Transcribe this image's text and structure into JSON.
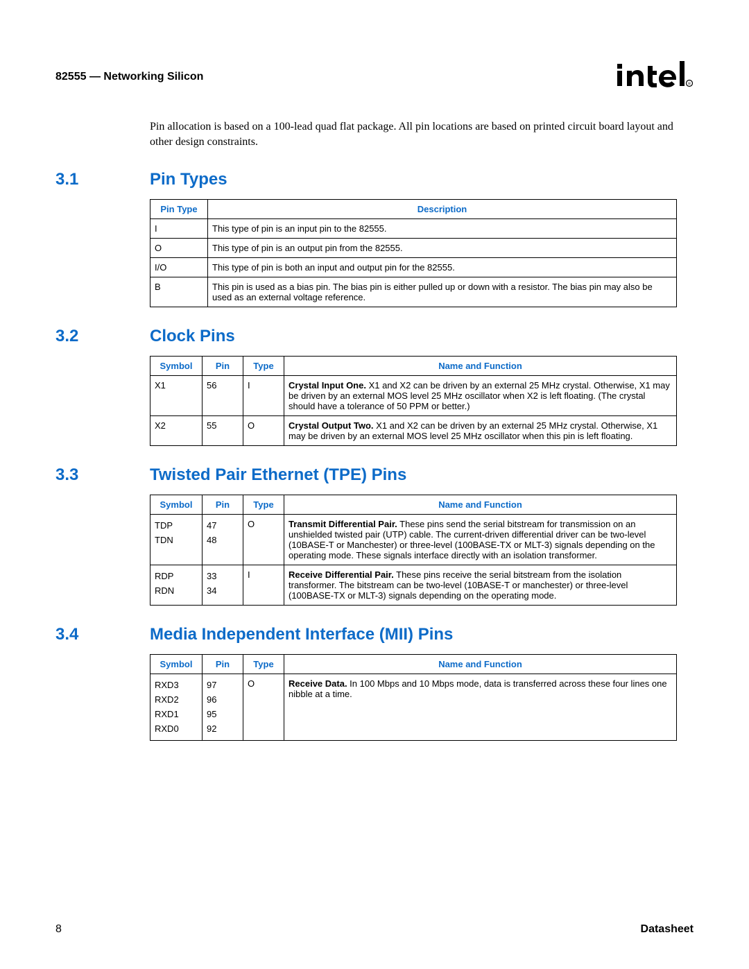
{
  "header": {
    "left": "82555 — Networking Silicon",
    "logo_alt": "intel"
  },
  "intro": "Pin allocation is based on a 100-lead quad flat package. All pin locations are based on printed circuit board layout and other design constraints.",
  "sections": {
    "s31": {
      "num": "3.1",
      "title": "Pin Types"
    },
    "s32": {
      "num": "3.2",
      "title": "Clock Pins"
    },
    "s33": {
      "num": "3.3",
      "title": "Twisted Pair Ethernet (TPE) Pins"
    },
    "s34": {
      "num": "3.4",
      "title": "Media Independent Interface (MII) Pins"
    }
  },
  "pin_type_table": {
    "headers": {
      "col0": "Pin Type",
      "col1": "Description"
    },
    "rows": [
      {
        "t": "I",
        "d": "This type of pin is an input pin to the 82555."
      },
      {
        "t": "O",
        "d": "This type of pin is an output pin from the 82555."
      },
      {
        "t": "I/O",
        "d": "This type of pin is both an input and output pin for the 82555."
      },
      {
        "t": "B",
        "d": "This pin is used as a bias pin. The bias pin is either pulled up or down with a resistor. The bias pin may also be used as an external voltage reference."
      }
    ]
  },
  "clock_table": {
    "headers": {
      "symbol": "Symbol",
      "pin": "Pin",
      "type": "Type",
      "func": "Name and Function"
    },
    "rows": [
      {
        "symbol": "X1",
        "pin": "56",
        "type": "I",
        "lead": "Crystal Input One.",
        "rest": " X1 and X2 can be driven by an external 25 MHz crystal. Otherwise, X1 may be driven by an external MOS level 25 MHz oscillator when X2 is left floating. (The crystal should have a tolerance of 50 PPM or better.)"
      },
      {
        "symbol": "X2",
        "pin": "55",
        "type": "O",
        "lead": "Crystal Output Two.",
        "rest": " X1 and X2 can be driven by an external 25 MHz crystal. Otherwise, X1 may be driven by an external MOS level 25 MHz oscillator when this pin is left floating."
      }
    ]
  },
  "tpe_table": {
    "headers": {
      "symbol": "Symbol",
      "pin": "Pin",
      "type": "Type",
      "func": "Name and Function"
    },
    "rows": [
      {
        "symbols": [
          "TDP",
          "TDN"
        ],
        "pins": [
          "47",
          "48"
        ],
        "type": "O",
        "lead": "Transmit Differential Pair.",
        "rest": " These pins send the serial bitstream for transmission on an unshielded twisted pair (UTP) cable. The current-driven differential driver can be two-level (10BASE-T or Manchester) or three-level (100BASE-TX or MLT-3) signals depending on the operating mode. These signals interface directly with an isolation transformer."
      },
      {
        "symbols": [
          "RDP",
          "RDN"
        ],
        "pins": [
          "33",
          "34"
        ],
        "type": "I",
        "lead": "Receive Differential Pair.",
        "rest": " These pins receive the serial bitstream from the isolation transformer. The bitstream can be two-level (10BASE-T or manchester) or three-level (100BASE-TX or MLT-3) signals depending on the operating mode."
      }
    ]
  },
  "mii_table": {
    "headers": {
      "symbol": "Symbol",
      "pin": "Pin",
      "type": "Type",
      "func": "Name and Function"
    },
    "rows": [
      {
        "symbols": [
          "RXD3",
          "RXD2",
          "RXD1",
          "RXD0"
        ],
        "pins": [
          "97",
          "96",
          "95",
          "92"
        ],
        "type": "O",
        "lead": "Receive Data.",
        "rest": " In 100 Mbps and 10 Mbps mode, data is transferred across these four lines one nibble at a time."
      }
    ]
  },
  "footer": {
    "left": "8",
    "right": "Datasheet"
  }
}
